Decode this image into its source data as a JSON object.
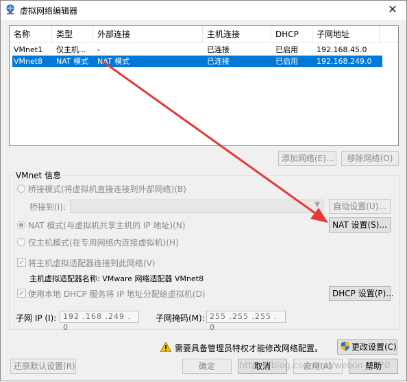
{
  "window": {
    "title": "虚拟网络编辑器",
    "close_glyph": "✕"
  },
  "table": {
    "columns": [
      "名称",
      "类型",
      "外部连接",
      "主机连接",
      "DHCP",
      "子网地址"
    ],
    "rows": [
      {
        "name": "VMnet1",
        "type": "仅主机...",
        "external": "-",
        "host": "已连接",
        "dhcp": "已启用",
        "subnet": "192.168.45.0",
        "selected": false
      },
      {
        "name": "VMnet8",
        "type": "NAT 模式",
        "external": "NAT 模式",
        "host": "已连接",
        "dhcp": "已启用",
        "subnet": "192.168.249.0",
        "selected": true
      }
    ]
  },
  "buttons": {
    "add_network": "添加网络(E)...",
    "remove_network": "移除网络(O)",
    "auto_settings": "自动设置(U)...",
    "nat_settings": "NAT 设置(S)...",
    "dhcp_settings": "DHCP 设置(P)...",
    "change_settings": "更改设置(C)",
    "restore_defaults": "还原默认设置(R)",
    "ok": "确定",
    "cancel": "取消",
    "apply": "应用(A)",
    "help": "帮助"
  },
  "vmnet_info": {
    "group_label": "VMnet 信息",
    "bridged_label": "桥接模式(将虚拟机直接连接到外部网络)(B)",
    "bridged_to_label": "桥接到(I):",
    "nat_label": "NAT 模式(与虚拟机共享主机的 IP 地址)(N)",
    "host_only_label": "仅主机模式(在专用网络内连接虚拟机)(H)",
    "connect_adapter_label": "将主机虚拟适配器连接到此网络(V)",
    "adapter_name_label": "主机虚拟适配器名称: VMware 网络适配器 VMnet8",
    "use_dhcp_label": "使用本地 DHCP 服务将 IP 地址分配给虚拟机(D)",
    "subnet_ip_label": "子网 IP (I):",
    "subnet_ip_value": "192 .168 .249 .  0",
    "subnet_mask_label": "子网掩码(M):",
    "subnet_mask_value": "255 .255 .255 .  0"
  },
  "admin_notice": "需要具备管理员特权才能修改网络配置。",
  "watermark": "https://blog.csdn.net/weixin_4220",
  "colors": {
    "selection": "#0078d7",
    "arrow": "#e53935",
    "window_bg": "#f0f0f0"
  }
}
